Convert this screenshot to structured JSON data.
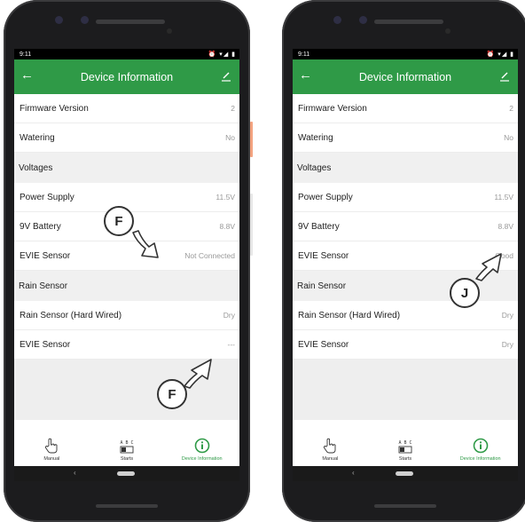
{
  "screens": [
    {
      "status_time": "9:11",
      "title": "Device Information",
      "rows": [
        {
          "label": "Firmware Version",
          "value": "2"
        },
        {
          "label": "Watering",
          "value": "No"
        }
      ],
      "voltages_header": "Voltages",
      "voltage_rows": [
        {
          "label": "Power Supply",
          "value": "11.5V"
        },
        {
          "label": "9V Battery",
          "value": "8.8V"
        },
        {
          "label": "EVIE Sensor",
          "value": "Not Connected"
        }
      ],
      "rain_header": "Rain Sensor",
      "rain_rows": [
        {
          "label": "Rain Sensor  (Hard Wired)",
          "value": "Dry"
        },
        {
          "label": "EVIE Sensor",
          "value": "---"
        }
      ],
      "tabs": [
        {
          "label": "Manual",
          "icon": "hand-pointer-icon"
        },
        {
          "label": "Starts",
          "icon": "abc-toggle-icon"
        },
        {
          "label": "Device Information",
          "icon": "info-icon"
        }
      ],
      "callouts": [
        "F",
        "F"
      ]
    },
    {
      "status_time": "9:11",
      "title": "Device Information",
      "rows": [
        {
          "label": "Firmware Version",
          "value": "2"
        },
        {
          "label": "Watering",
          "value": "No"
        }
      ],
      "voltages_header": "Voltages",
      "voltage_rows": [
        {
          "label": "Power Supply",
          "value": "11.5V"
        },
        {
          "label": "9V Battery",
          "value": "8.8V"
        },
        {
          "label": "EVIE Sensor",
          "value": "Good"
        }
      ],
      "rain_header": "Rain Sensor",
      "rain_rows": [
        {
          "label": "Rain Sensor  (Hard Wired)",
          "value": "Dry"
        },
        {
          "label": "EVIE Sensor",
          "value": "Dry"
        }
      ],
      "tabs": [
        {
          "label": "Manual",
          "icon": "hand-pointer-icon"
        },
        {
          "label": "Starts",
          "icon": "abc-toggle-icon"
        },
        {
          "label": "Device Information",
          "icon": "info-icon"
        }
      ],
      "callouts": [
        "J"
      ]
    }
  ],
  "tab_icon_text": "A B C",
  "colors": {
    "appbar": "#2f9a47",
    "active_tab": "#2f9a47",
    "side_accent": "#f2a27f"
  }
}
